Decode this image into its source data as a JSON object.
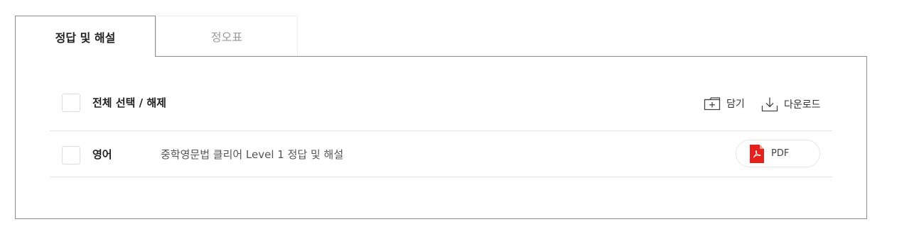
{
  "tabs": [
    {
      "label": "정답 및 해설",
      "active": true
    },
    {
      "label": "정오표",
      "active": false
    }
  ],
  "toolbar": {
    "select_all_label": "전체 선택 / 해제",
    "save_label": "담기",
    "download_label": "다운로드",
    "save_icon": "folder-plus-icon",
    "download_icon": "download-icon"
  },
  "rows": [
    {
      "subject": "영어",
      "title": "중학영문법 클리어 Level 1 정답 및 해설",
      "file_type": "PDF",
      "file_icon": "pdf-icon"
    }
  ],
  "colors": {
    "pdf_red": "#e3221d",
    "border": "#8d8d8d",
    "divider": "#e3e3e3"
  }
}
